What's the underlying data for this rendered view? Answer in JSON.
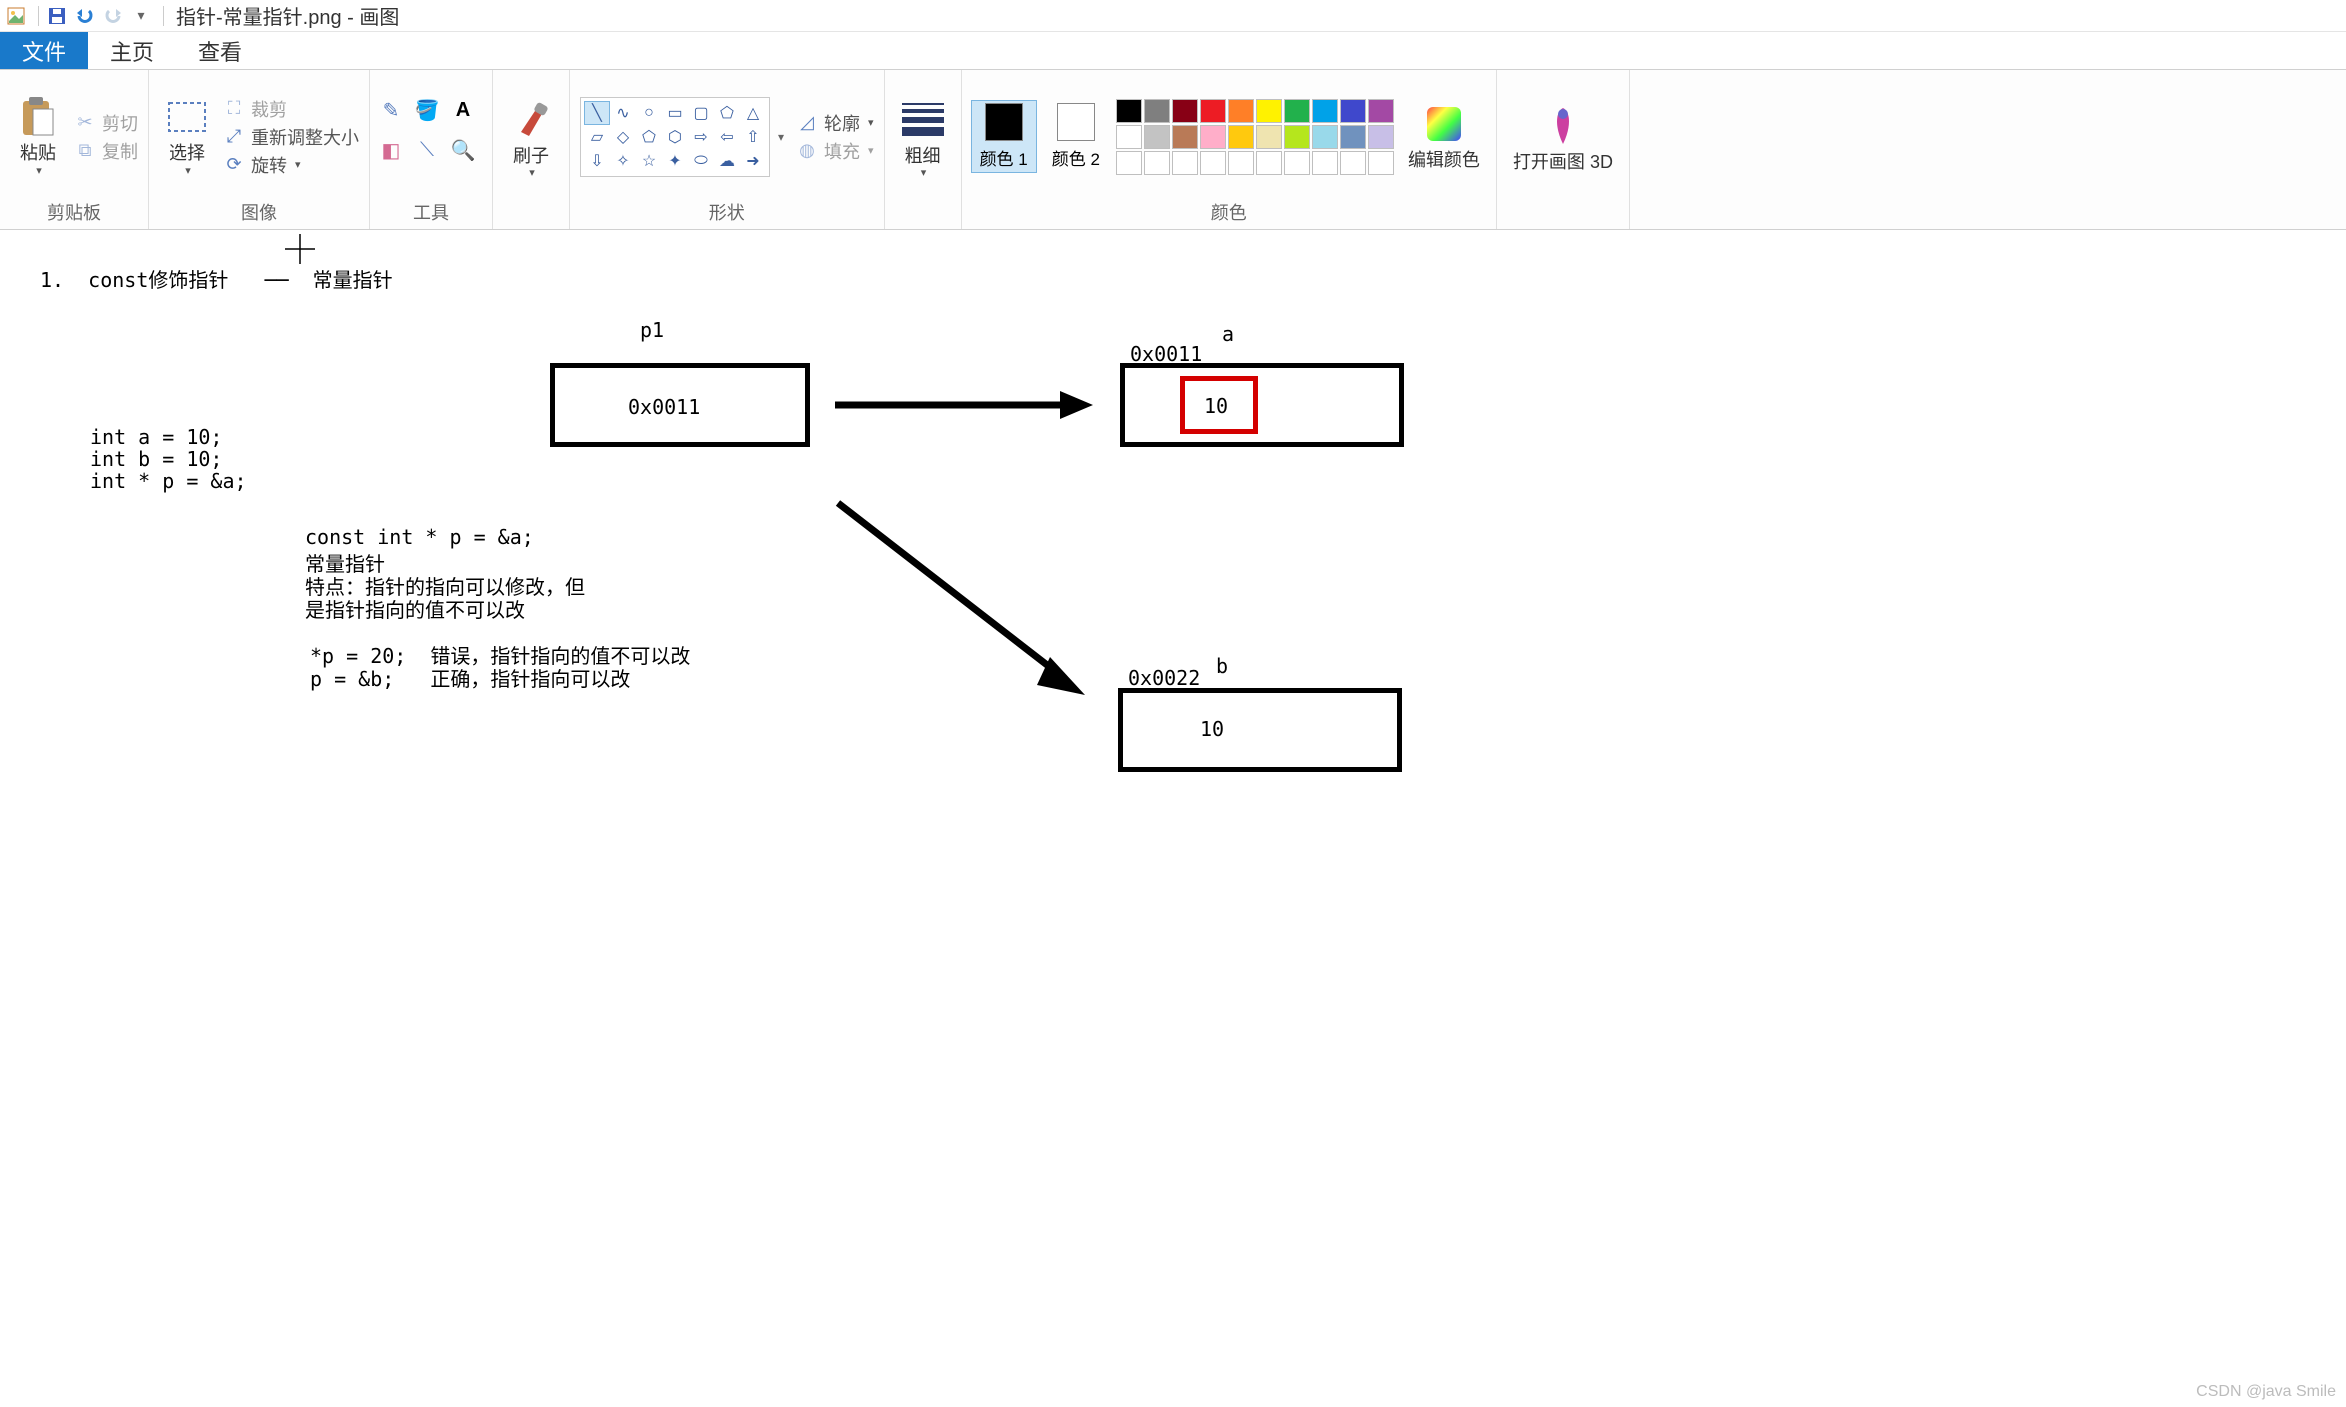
{
  "titlebar": {
    "filename": "指针-常量指针.png",
    "app": "画图"
  },
  "tabs": {
    "file": "文件",
    "home": "主页",
    "view": "查看"
  },
  "ribbon": {
    "clipboard": {
      "paste": "粘贴",
      "cut": "剪切",
      "copy": "复制",
      "label": "剪贴板"
    },
    "image": {
      "select": "选择",
      "crop": "裁剪",
      "resize": "重新调整大小",
      "rotate": "旋转",
      "label": "图像"
    },
    "tools": {
      "label": "工具"
    },
    "brush": {
      "label": "刷子"
    },
    "shapes": {
      "outline": "轮廓",
      "fill": "填充",
      "label": "形状"
    },
    "size": {
      "label": "粗细"
    },
    "colors": {
      "c1": "颜色 1",
      "c2": "颜色 2",
      "edit": "编辑颜色",
      "label": "颜色"
    },
    "p3d": {
      "label": "打开画图 3D"
    }
  },
  "palette_colors": [
    "#000000",
    "#7f7f7f",
    "#880015",
    "#ed1c24",
    "#ff7f27",
    "#fff200",
    "#22b14c",
    "#00a2e8",
    "#3f48cc",
    "#a349a4",
    "#ffffff",
    "#c3c3c3",
    "#b97a57",
    "#ffaec9",
    "#ffc90e",
    "#efe4b0",
    "#b5e61d",
    "#99d9ea",
    "#7092be",
    "#c8bfe7"
  ],
  "canvas": {
    "heading": "1.  const修饰指针   ──  常量指针",
    "decl1": "int a = 10;",
    "decl2": "int b = 10;",
    "decl3": "int * p = &a;",
    "p1_label": "p1",
    "p1_value": "0x0011",
    "a_label": "a",
    "a_addr": "0x0011",
    "a_value": "10",
    "b_label": "b",
    "b_addr": "0x0022",
    "b_value": "10",
    "const_line1": "const int * p = &a;",
    "const_line2": "常量指针",
    "const_line3": "特点：指针的指向可以修改，但",
    "const_line4": "是指针指向的值不可以改",
    "err_line1": "*p = 20;  错误，指针指向的值不可以改",
    "err_line2": "p = &b;   正确，指针指向可以改"
  },
  "watermark": "CSDN @java Smile"
}
